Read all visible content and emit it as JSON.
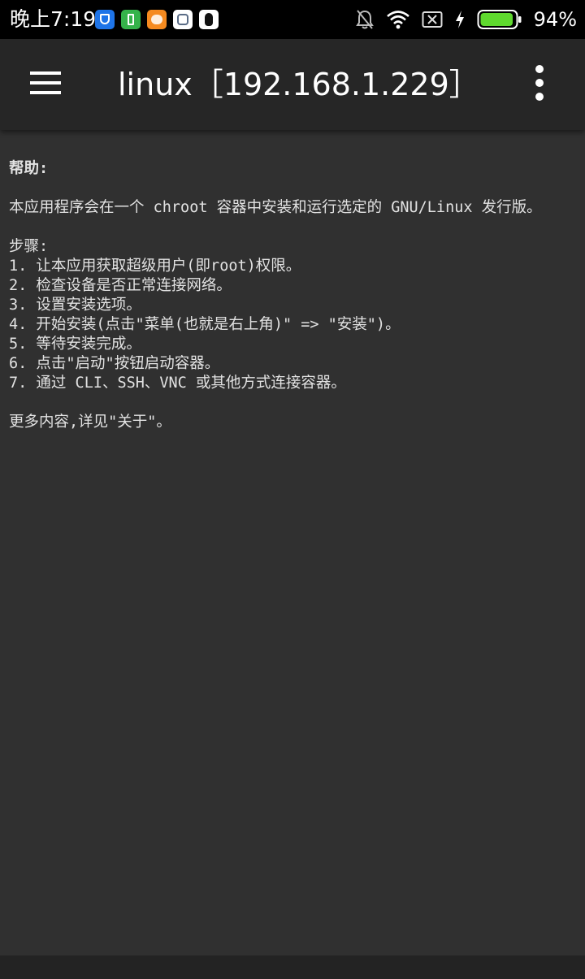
{
  "status_bar": {
    "time": "晚上7:19",
    "notification_icons": [
      "security-shield-icon",
      "battery-saver-icon",
      "uc-browser-icon",
      "window-app-icon",
      "qq-penguin-icon"
    ],
    "system_icons": [
      "mute-bell-icon",
      "wifi-icon",
      "no-sim-icon",
      "charging-bolt-icon",
      "battery-icon"
    ],
    "battery_level": 0.94,
    "battery_percent": "94%"
  },
  "app_bar": {
    "title": "linux［192.168.1.229］",
    "menu_icon": "hamburger-menu-icon",
    "overflow_icon": "more-vert-icon"
  },
  "help": {
    "heading": "帮助:",
    "intro": "本应用程序会在一个 chroot 容器中安装和运行选定的 GNU/Linux 发行版。",
    "steps_heading": "步骤:",
    "steps": [
      "1. 让本应用获取超级用户(即root)权限。",
      "2. 检查设备是否正常连接网络。",
      "3. 设置安装选项。",
      "4. 开始安装(点击\"菜单(也就是右上角)\" => \"安装\")。",
      "5. 等待安装完成。",
      "6. 点击\"启动\"按钮启动容器。",
      "7. 通过 CLI、SSH、VNC 或其他方式连接容器。"
    ],
    "footer": "更多内容,详见\"关于\"。"
  },
  "colors": {
    "background": "#303030",
    "app_bar": "#262626",
    "status_bar": "#000000",
    "text": "#e2e2e2",
    "battery_fill": "#5fd92e"
  }
}
